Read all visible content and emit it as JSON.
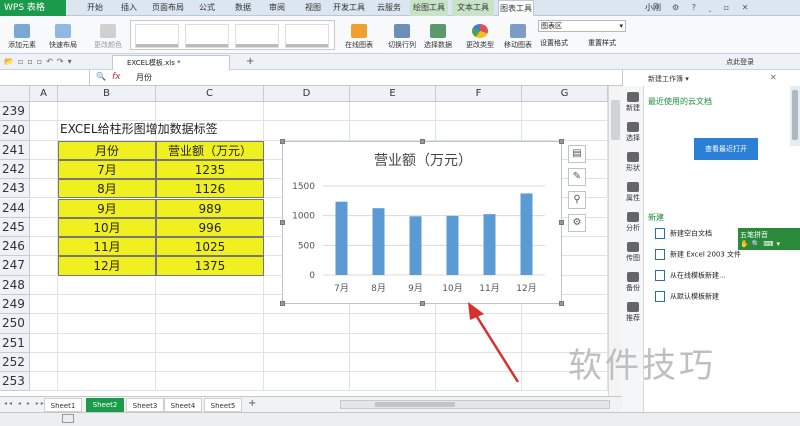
{
  "app": {
    "name": "WPS 表格"
  },
  "tabs": [
    "开始",
    "插入",
    "页面布局",
    "公式",
    "数据",
    "审阅",
    "视图",
    "开发工具",
    "云服务",
    "绘图工具",
    "文本工具",
    "图表工具"
  ],
  "user": "小刚",
  "ribbon": {
    "add_element": "添加元素",
    "quick_layout": "快速布局",
    "change_color": "更改颜色",
    "online_chart": "在线图表",
    "switch_row_col": "切换行列",
    "select_data": "选择数据",
    "change_type": "更改类型",
    "move_chart": "移动图表",
    "chart_area": "图表区",
    "set_format": "设置格式",
    "reset_style": "重置样式"
  },
  "file_tab": "EXCEL模板.xls *",
  "login": "点此登录",
  "formula_bar": {
    "fx": "fx",
    "content": "月份"
  },
  "columns": [
    "A",
    "B",
    "C",
    "D",
    "E",
    "F",
    "G"
  ],
  "rows": [
    "239",
    "240",
    "241",
    "242",
    "243",
    "244",
    "245",
    "246",
    "247",
    "248",
    "249",
    "250",
    "251",
    "252",
    "253"
  ],
  "sheet": {
    "title": "EXCEL给柱形图增加数据标签",
    "table_header": [
      "月份",
      "营业额（万元）"
    ],
    "table_rows": [
      [
        "7月",
        "1235"
      ],
      [
        "8月",
        "1126"
      ],
      [
        "9月",
        "989"
      ],
      [
        "10月",
        "996"
      ],
      [
        "11月",
        "1025"
      ],
      [
        "12月",
        "1375"
      ]
    ]
  },
  "chart_data": {
    "type": "bar",
    "title": "营业额（万元）",
    "categories": [
      "7月",
      "8月",
      "9月",
      "10月",
      "11月",
      "12月"
    ],
    "values": [
      1235,
      1126,
      989,
      996,
      1025,
      1375
    ],
    "yticks": [
      "0",
      "500",
      "1000",
      "1500"
    ],
    "ylim": [
      0,
      1500
    ],
    "color": "#5b9bd5"
  },
  "right_panel": {
    "header": "新建工作簿",
    "tabs": [
      "新建",
      "选择",
      "形状",
      "属性",
      "分析",
      "传图",
      "备份",
      "推荐"
    ],
    "recent_label": "最近使用的云文档",
    "recent_btn": "查看最近打开",
    "new_label": "新建",
    "items": [
      "新建空白文档",
      "新建 Excel 2003 文件",
      "从在线模板新建...",
      "从默认模板新建"
    ]
  },
  "sheet_tabs": [
    "Sheet1",
    "Sheet2",
    "Sheet3",
    "Sheet4",
    "Sheet5"
  ],
  "active_sheet_color": "#1a9a4a",
  "ime_label": "五笔拼音",
  "watermark": "软件技巧"
}
